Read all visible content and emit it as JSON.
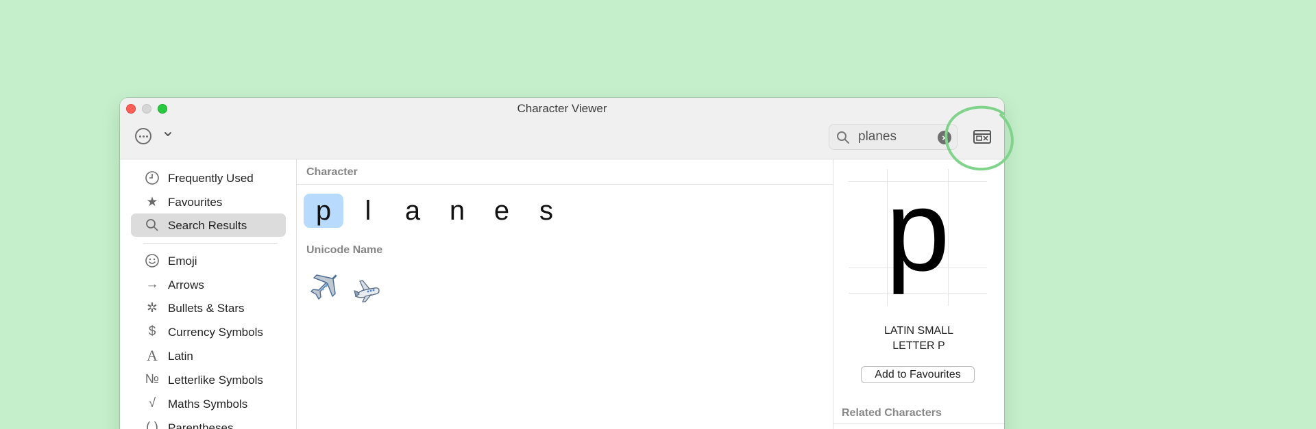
{
  "window": {
    "title": "Character Viewer"
  },
  "toolbar": {
    "more_icon": "ellipsis-circle-icon",
    "chevron_icon": "chevron-down-icon",
    "search": {
      "value": "planes"
    },
    "viewer_icon": "keyboard-viewer-icon"
  },
  "sidebar": {
    "items": [
      {
        "label": "Frequently Used",
        "icon": "clock-icon"
      },
      {
        "label": "Favourites",
        "icon": "star-icon"
      },
      {
        "label": "Search Results",
        "icon": "search-icon"
      },
      {
        "label": "Emoji",
        "icon": "smiley-icon"
      },
      {
        "label": "Arrows",
        "icon": "arrow-icon"
      },
      {
        "label": "Bullets & Stars",
        "icon": "asterisk-icon"
      },
      {
        "label": "Currency Symbols",
        "icon": "dollar-icon"
      },
      {
        "label": "Latin",
        "icon": "latin-a-icon"
      },
      {
        "label": "Letterlike Symbols",
        "icon": "numero-icon"
      },
      {
        "label": "Maths Symbols",
        "icon": "square-root-icon"
      },
      {
        "label": "Parentheses",
        "icon": "parentheses-icon"
      }
    ],
    "selected": "Search Results"
  },
  "main": {
    "character_header": "Character",
    "characters": [
      "p",
      "l",
      "a",
      "n",
      "e",
      "s"
    ],
    "selected_character": "p",
    "unicode_header": "Unicode Name",
    "emojis": [
      "airplane-emoji",
      "small-airplane-emoji"
    ]
  },
  "inspector": {
    "glyph": "p",
    "name_line1": "LATIN SMALL",
    "name_line2": "LETTER P",
    "favourite_button": "Add to Favourites",
    "related_header": "Related Characters"
  },
  "colors": {
    "background": "#c4efca",
    "selection_blue": "#b8dafc",
    "annotation_green": "#7fd38a"
  }
}
